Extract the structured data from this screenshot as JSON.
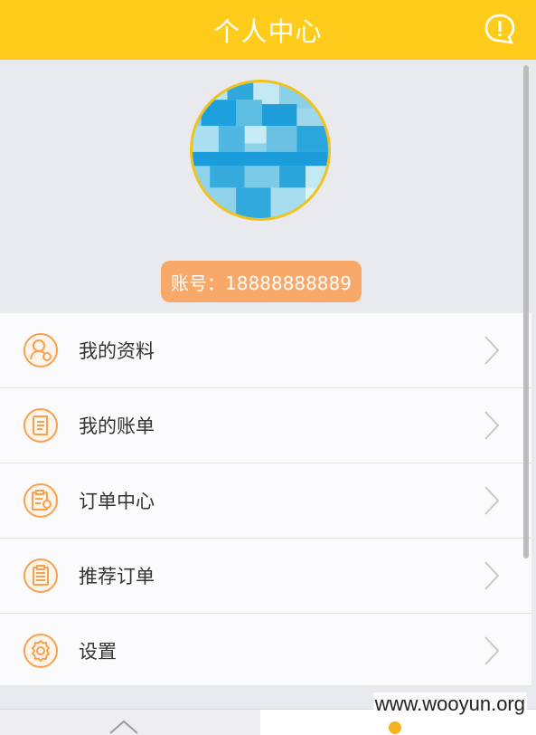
{
  "header": {
    "title": "个人中心",
    "help_icon": "help-chat-icon"
  },
  "profile": {
    "account_text": "账号：18888888889"
  },
  "menu": {
    "items": [
      {
        "label": "我的资料",
        "icon": "profile-icon"
      },
      {
        "label": "我的账单",
        "icon": "bill-icon"
      },
      {
        "label": "订单中心",
        "icon": "order-center-icon"
      },
      {
        "label": "推荐订单",
        "icon": "recommend-order-icon"
      },
      {
        "label": "设置",
        "icon": "settings-icon"
      }
    ]
  },
  "watermark": "www.wooyun.org",
  "colors": {
    "accent": "#ffcc1c",
    "badge": "#f8a96a",
    "icon_orange": "#f5a150"
  }
}
